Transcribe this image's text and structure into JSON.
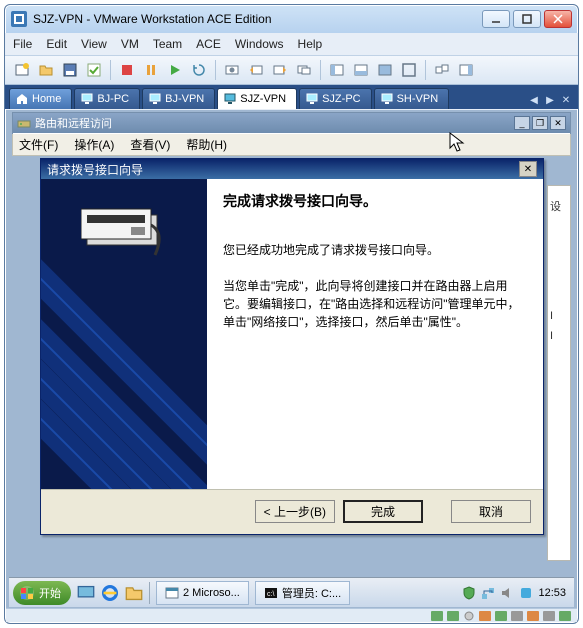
{
  "window": {
    "title": "SJZ-VPN - VMware Workstation ACE Edition"
  },
  "menu": [
    "File",
    "Edit",
    "View",
    "VM",
    "Team",
    "ACE",
    "Windows",
    "Help"
  ],
  "tabs": {
    "home": "Home",
    "items": [
      "BJ-PC",
      "BJ-VPN",
      "SJZ-VPN",
      "SJZ-PC",
      "SH-VPN"
    ],
    "active_index": 2
  },
  "mmc": {
    "title": "路由和远程访问",
    "menu": [
      "文件(F)",
      "操作(A)",
      "查看(V)",
      "帮助(H)"
    ]
  },
  "right_panel": {
    "txt1": "设",
    "txt2": "I",
    "txt3": "I"
  },
  "wizard": {
    "title": "请求拨号接口向导",
    "heading": "完成请求拨号接口向导。",
    "p1": "您已经成功地完成了请求拨号接口向导。",
    "p2": "当您单击\"完成\"，此向导将创建接口并在路由器上启用它。要编辑接口，在\"路由选择和远程访问\"管理单元中，单击\"网络接口\"，选择接口，然后单击\"属性\"。",
    "back": "< 上一步(B)",
    "finish": "完成",
    "cancel": "取消"
  },
  "taskbar": {
    "start": "开始",
    "task1": "2 Microso...",
    "task2": "管理员: C:...",
    "clock": "12:53"
  }
}
